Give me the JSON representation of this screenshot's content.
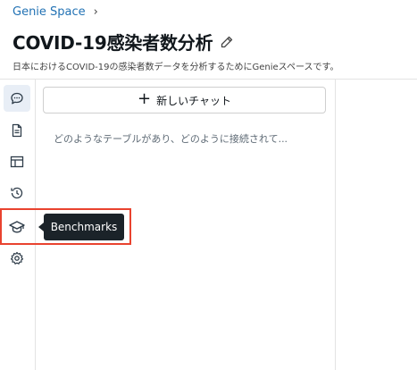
{
  "breadcrumb": {
    "space_label": "Genie Space",
    "separator": "›"
  },
  "header": {
    "title": "COVID-19感染者数分析",
    "description": "日本におけるCOVID-19の感染者数データを分析するためにGenieスペースです。"
  },
  "rail": {
    "items": [
      {
        "icon": "chat-icon",
        "active": true
      },
      {
        "icon": "document-icon",
        "active": false
      },
      {
        "icon": "table-icon",
        "active": false
      },
      {
        "icon": "history-icon",
        "active": false
      },
      {
        "icon": "graduation-cap-icon",
        "active": false
      },
      {
        "icon": "gear-icon",
        "active": false
      }
    ]
  },
  "chat_panel": {
    "new_chat_label": "新しいチャット",
    "history": [
      {
        "text": "どのようなテーブルがあり、どのように接続されて..."
      }
    ]
  },
  "tooltip": {
    "text": "Benchmarks"
  },
  "colors": {
    "link": "#2272b4",
    "highlight": "#e9432f",
    "tooltip_bg": "#1b2329",
    "active_rail_bg": "#e8eef6"
  }
}
